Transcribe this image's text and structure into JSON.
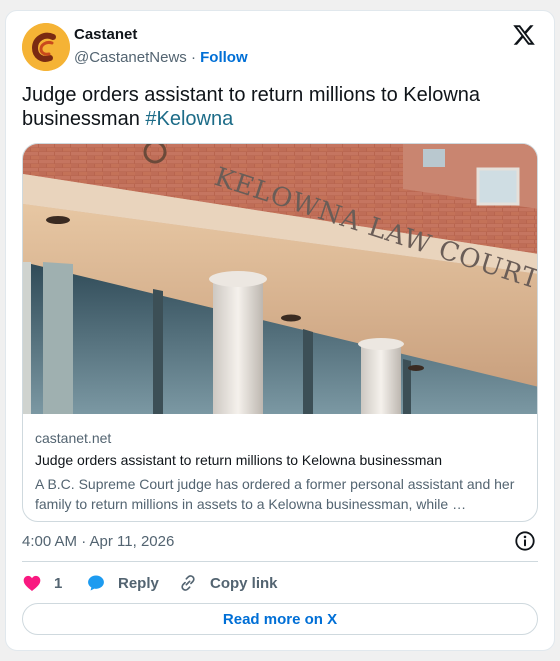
{
  "author": {
    "name": "Castanet",
    "handle": "@CastanetNews",
    "separator": "·",
    "follow_label": "Follow",
    "avatar_icon": "castanet-logo-icon",
    "avatar_color": "#f5b335"
  },
  "platform_icon": "x-logo-icon",
  "tweet": {
    "text": "Judge orders assistant to return millions to Kelowna businessman",
    "hashtag": "#Kelowna"
  },
  "link_card": {
    "image_sign_text": "KELOWNA LAW COURTS",
    "domain": "castanet.net",
    "title": "Judge orders assistant to return millions to Kelowna businessman",
    "description": "A B.C. Supreme Court judge has ordered a former personal assistant and her family to return millions in assets to a Kelowna businessman, while …"
  },
  "timestamp": "4:00 AM · Apr 11, 2026",
  "actions": {
    "like_count": "1",
    "reply_label": "Reply",
    "copy_label": "Copy link"
  },
  "read_more_label": "Read more on X",
  "colors": {
    "link": "#006fd6",
    "hashtag": "#1d6c88",
    "like": "#f91880",
    "reply": "#1d9bf0",
    "muted": "#536471"
  }
}
